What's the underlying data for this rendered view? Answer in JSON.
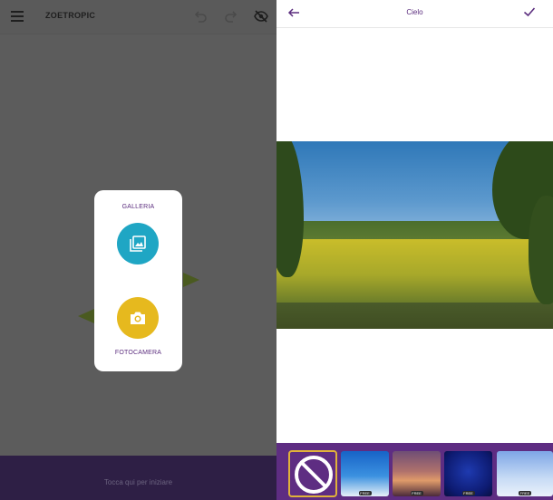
{
  "left_screen": {
    "app_title": "ZOETROPIC",
    "icons": {
      "menu": "hamburger-menu-icon",
      "undo": "undo-icon",
      "redo": "redo-icon",
      "hide": "eye-off-icon"
    },
    "picker": {
      "gallery_label": "GALLERIA",
      "camera_label": "FOTOCAMERA",
      "gallery_icon": "image-gallery-icon",
      "camera_icon": "camera-icon",
      "gallery_color": "#1fa6c4",
      "camera_color": "#e6b91e"
    },
    "bottom_hint": "Tocca qui per iniziare"
  },
  "right_screen": {
    "title": "Cielo",
    "icons": {
      "back": "arrow-left-icon",
      "confirm": "checkmark-icon",
      "none": "no-sky-icon"
    },
    "thumbnails": [
      {
        "name": "none",
        "badge": ""
      },
      {
        "name": "blue-sky-clouds",
        "badge": "FREE"
      },
      {
        "name": "sunset-clouds",
        "badge": "FREE"
      },
      {
        "name": "deep-blue-sky",
        "badge": "FREE"
      },
      {
        "name": "light-sky",
        "badge": "FREE"
      }
    ],
    "accent_color": "#5e2d82",
    "selection_color": "#e0b23a"
  }
}
